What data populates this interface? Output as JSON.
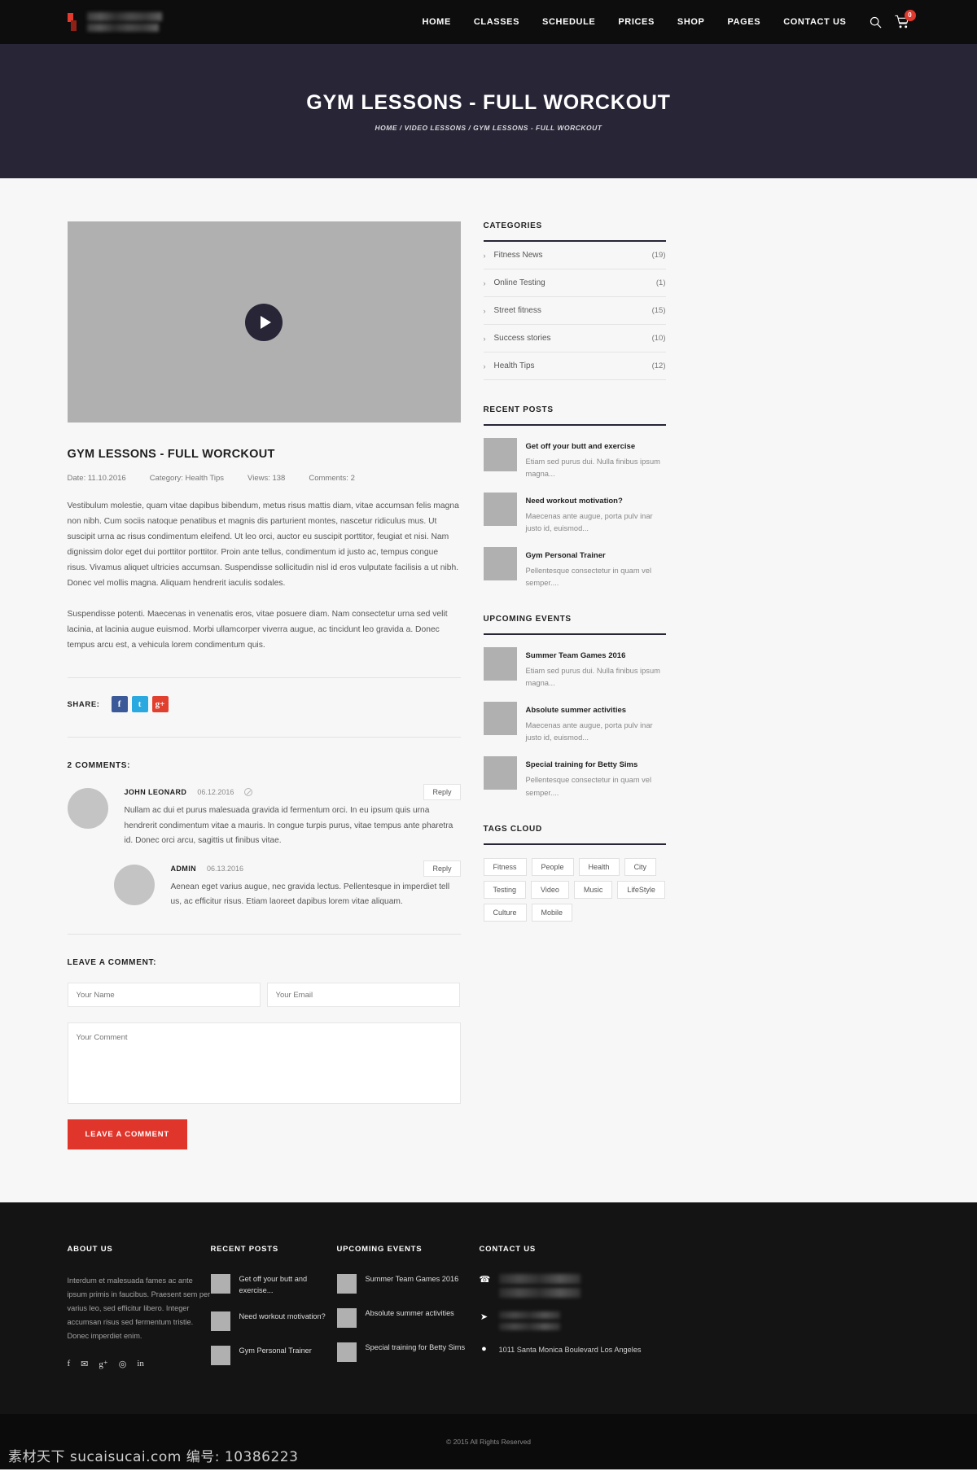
{
  "header": {
    "logo_icon": "flame-logo-icon",
    "nav": [
      {
        "label": "HOME"
      },
      {
        "label": "CLASSES"
      },
      {
        "label": "SCHEDULE"
      },
      {
        "label": "PRICES"
      },
      {
        "label": "SHOP"
      },
      {
        "label": "PAGES"
      },
      {
        "label": "CONTACT US"
      }
    ],
    "search_icon": "search-icon",
    "cart_icon": "cart-icon",
    "cart_count": "0"
  },
  "hero": {
    "title": "GYM LESSONS - FULL WORCKOUT",
    "breadcrumb": "HOME / VIDEO LESSONS / GYM LESSONS - FULL WORCKOUT"
  },
  "post": {
    "play_icon": "play-icon",
    "title": "GYM LESSONS - FULL WORCKOUT",
    "meta": {
      "date": "Date:  11.10.2016",
      "category": "Category:  Health Tips",
      "views": "Views: 138",
      "comments": "Comments: 2"
    },
    "paragraphs": [
      "Vestibulum molestie, quam vitae dapibus bibendum, metus risus mattis diam, vitae accumsan felis magna non nibh. Cum sociis natoque penatibus et magnis dis parturient montes, nascetur ridiculus mus. Ut suscipit urna ac risus condimentum eleifend. Ut leo orci, auctor eu suscipit porttitor, feugiat et nisi. Nam dignissim dolor eget dui porttitor porttitor. Proin ante tellus, condimentum id justo ac, tempus congue risus. Vivamus aliquet ultricies accumsan. Suspendisse sollicitudin nisl id eros vulputate facilisis a ut nibh. Donec vel mollis magna. Aliquam hendrerit iaculis sodales.",
      "Suspendisse potenti. Maecenas in venenatis eros, vitae posuere diam. Nam consectetur urna sed velit lacinia, at lacinia augue euismod. Morbi ullamcorper viverra augue, ac tincidunt leo gravida a. Donec tempus arcu est, a vehicula lorem condimentum quis."
    ],
    "share_label": "SHARE:",
    "share_buttons": [
      {
        "name": "facebook-share-button",
        "glyph": "f"
      },
      {
        "name": "twitter-share-button",
        "glyph": "t"
      },
      {
        "name": "google-plus-share-button",
        "glyph": "g+"
      }
    ]
  },
  "comments": {
    "heading": "2 COMMENTS:",
    "reply_label": "Reply",
    "items": [
      {
        "author": "JOHN LEONARD",
        "date": "06.12.2016",
        "text": "Nullam ac dui et purus malesuada gravida id fermentum orci. In eu ipsum quis urna hendrerit condimentum vitae a mauris. In congue turpis purus, vitae tempus ante pharetra id. Donec orci arcu, sagittis ut finibus vitae.",
        "nested": false
      },
      {
        "author": "ADMIN",
        "date": "06.13.2016",
        "text": "Aenean eget varius augue, nec gravida lectus. Pellentesque in imperdiet tell us, ac efficitur risus. Etiam laoreet dapibus lorem vitae aliquam.",
        "nested": true
      }
    ]
  },
  "comment_form": {
    "heading": "LEAVE A COMMENT:",
    "name_placeholder": "Your Name",
    "email_placeholder": "Your Email",
    "comment_placeholder": "Your Comment",
    "submit_label": "LEAVE A COMMENT"
  },
  "sidebar": {
    "categories": {
      "title": "CATEGORIES",
      "items": [
        {
          "label": "Fitness News",
          "count": "(19)"
        },
        {
          "label": "Online Testing",
          "count": "(1)"
        },
        {
          "label": "Street fitness",
          "count": "(15)"
        },
        {
          "label": "Success stories",
          "count": "(10)"
        },
        {
          "label": "Health Tips",
          "count": "(12)"
        }
      ]
    },
    "recent_posts": {
      "title": "RECENT POSTS",
      "items": [
        {
          "title": "Get off your butt and exercise",
          "excerpt": "Etiam sed purus dui. Nulla finibus ipsum magna..."
        },
        {
          "title": "Need workout motivation?",
          "excerpt": "Maecenas ante augue, porta pulv inar justo id, euismod..."
        },
        {
          "title": "Gym Personal Trainer",
          "excerpt": "Pellentesque consectetur in quam vel semper...."
        }
      ]
    },
    "upcoming_events": {
      "title": "UPCOMING EVENTS",
      "items": [
        {
          "title": "Summer Team Games 2016",
          "excerpt": "Etiam sed purus dui. Nulla finibus ipsum magna..."
        },
        {
          "title": "Absolute summer activities",
          "excerpt": "Maecenas ante augue, porta pulv inar justo id, euismod..."
        },
        {
          "title": "Special training for Betty Sims",
          "excerpt": "Pellentesque consectetur in quam vel semper...."
        }
      ]
    },
    "tags_cloud": {
      "title": "TAGS CLOUD",
      "tags": [
        "Fitness",
        "People",
        "Health",
        "City",
        "Testing",
        "Video",
        "Music",
        "LifeStyle",
        "Culture",
        "Mobile"
      ]
    }
  },
  "footer": {
    "about": {
      "title": "ABOUT US",
      "text": "Interdum et malesuada fames ac ante ipsum primis in faucibus. Praesent sem per varius leo, sed efficitur libero. Integer accumsan risus sed fermentum tristie. Donec imperdiet enim.",
      "social": [
        {
          "name": "facebook-icon",
          "glyph": "f"
        },
        {
          "name": "twitter-icon",
          "glyph": "✉"
        },
        {
          "name": "google-plus-icon",
          "glyph": "g⁺"
        },
        {
          "name": "dribbble-icon",
          "glyph": "◎"
        },
        {
          "name": "linkedin-icon",
          "glyph": "in"
        }
      ]
    },
    "recent_posts": {
      "title": "RECENT POSTS",
      "items": [
        {
          "title": "Get off your butt and exercise..."
        },
        {
          "title": "Need workout motivation?"
        },
        {
          "title": "Gym Personal Trainer"
        }
      ]
    },
    "upcoming_events": {
      "title": "UPCOMING EVENTS",
      "items": [
        {
          "title": "Summer Team Games 2016"
        },
        {
          "title": "Absolute summer activities"
        },
        {
          "title": "Special training for Betty Sims"
        }
      ]
    },
    "contact": {
      "title": "CONTACT US",
      "phone_icon": "phone-icon",
      "mail_icon": "paper-plane-icon",
      "pin_icon": "map-pin-icon",
      "address": "1011 Santa Monica Boulevard Los Angeles"
    },
    "copyright": "© 2015 All Rights Reserved",
    "watermark": "素材天下 sucaisucai.com 编号: 10386223"
  }
}
